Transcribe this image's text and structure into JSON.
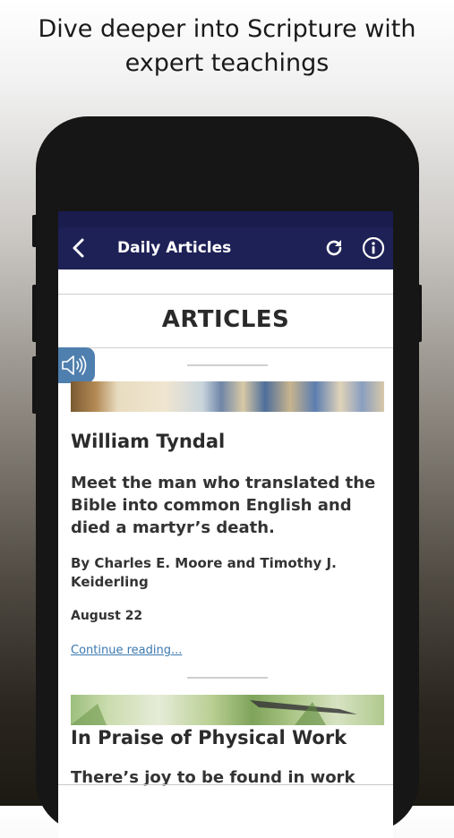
{
  "headline": {
    "line1": "Dive deeper into Scripture with",
    "line2": "expert teachings"
  },
  "navbar": {
    "title": "Daily Articles",
    "back_icon": "chevron-left-icon",
    "refresh_icon": "refresh-icon",
    "info_icon": "info-icon"
  },
  "section": {
    "title": "ARTICLES"
  },
  "audio": {
    "icon": "speaker-icon"
  },
  "articles": [
    {
      "title": "William Tyndal",
      "summary": "Meet the man who translated the Bible into common English and died a martyr’s death.",
      "author": "By Charles E. Moore and Timothy J. Keiderling",
      "date": "August 22",
      "link": "Continue reading..."
    },
    {
      "title": "In Praise of Physical Work",
      "summary": "There’s joy to be found in work"
    }
  ],
  "colors": {
    "navbar": "#1e2156",
    "accent_audio": "#4f7fae",
    "link": "#3a78b0"
  }
}
